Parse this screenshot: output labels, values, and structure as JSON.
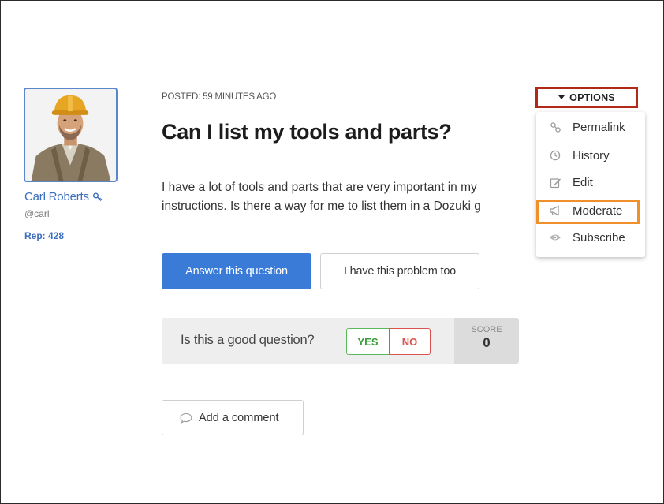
{
  "author": {
    "name": "Carl Roberts",
    "handle": "@carl",
    "rep": "Rep: 428"
  },
  "post": {
    "posted": "POSTED: 59 MINUTES AGO",
    "title": "Can I list my tools and parts?",
    "body_line1": "I have a lot of tools and parts that are very important in my",
    "body_line2": "instructions. Is there a way for me to list them in a Dozuki g"
  },
  "actions": {
    "answer_label": "Answer this question",
    "problem_label": "I have this problem too"
  },
  "vote": {
    "question": "Is this a good question?",
    "yes": "YES",
    "no": "NO",
    "score_label": "SCORE",
    "score_value": "0"
  },
  "comment": {
    "label": "Add a comment"
  },
  "options": {
    "label": "OPTIONS",
    "items": [
      {
        "label": "Permalink",
        "icon": "link-icon"
      },
      {
        "label": "History",
        "icon": "clock-icon"
      },
      {
        "label": "Edit",
        "icon": "edit-icon"
      },
      {
        "label": "Moderate",
        "icon": "megaphone-icon"
      },
      {
        "label": "Subscribe",
        "icon": "eye-icon"
      }
    ]
  },
  "colors": {
    "primary": "#3a7bd8",
    "link": "#3a6dc0",
    "options_highlight": "#b22a17",
    "moderate_highlight": "#f0902a",
    "yes": "#5cb85c",
    "no": "#d9534f"
  }
}
